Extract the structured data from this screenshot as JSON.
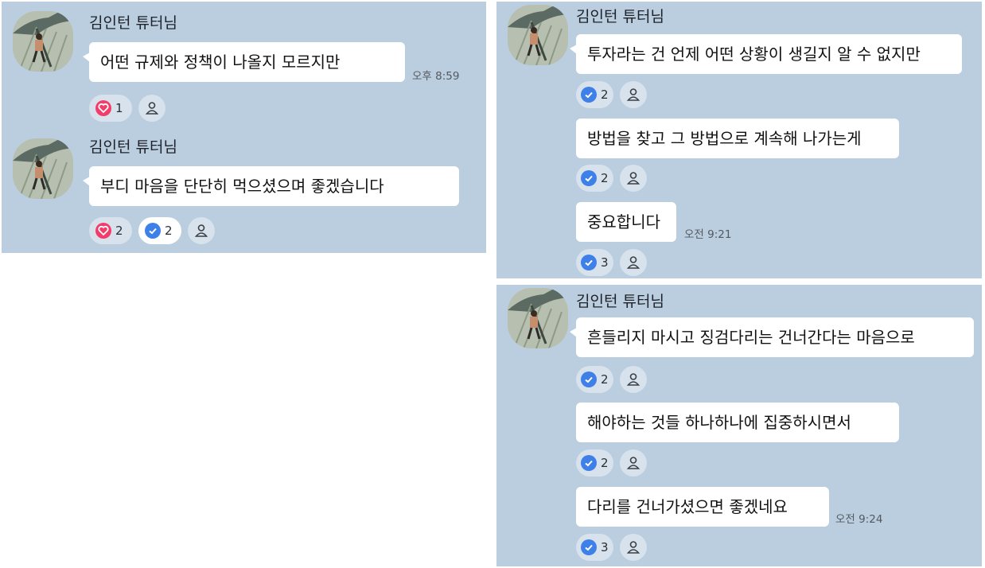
{
  "colors": {
    "panel_bg": "#bacee0",
    "bubble_bg": "#ffffff",
    "heart_red": "#f23c6a",
    "check_blue": "#3e80e8",
    "pill_bg": "#d7e2ec"
  },
  "panels": [
    {
      "groups": [
        {
          "sender": "김인턴 튜터님",
          "messages": [
            {
              "text": "어떤 규제와 정책이 나올지 모르지만",
              "time": "오후 8:59",
              "reactions": [
                {
                  "type": "heart",
                  "count": "1"
                }
              ]
            }
          ]
        },
        {
          "sender": "김인턴 튜터님",
          "messages": [
            {
              "text": "부디 마음을 단단히 먹으셨으며 좋겠습니다",
              "time": "",
              "reactions": [
                {
                  "type": "heart",
                  "count": "2"
                },
                {
                  "type": "check",
                  "count": "2",
                  "selected": true
                }
              ]
            }
          ]
        }
      ]
    },
    {
      "groups": [
        {
          "sender": "김인턴 튜터님",
          "messages": [
            {
              "text": "투자라는 건 언제 어떤 상황이 생길지 알 수 없지만",
              "time": "",
              "reactions": [
                {
                  "type": "check",
                  "count": "2"
                }
              ]
            },
            {
              "text": "방법을 찾고 그 방법으로 계속해 나가는게",
              "time": "",
              "reactions": [
                {
                  "type": "check",
                  "count": "2"
                }
              ]
            },
            {
              "text": "중요합니다",
              "time": "오전 9:21",
              "reactions": [
                {
                  "type": "check",
                  "count": "3"
                }
              ]
            }
          ]
        }
      ]
    },
    {
      "groups": [
        {
          "sender": "김인턴 튜터님",
          "messages": [
            {
              "text": "흔들리지 마시고 징검다리는 건너간다는 마음으로",
              "time": "",
              "reactions": [
                {
                  "type": "check",
                  "count": "2"
                }
              ]
            },
            {
              "text": "해야하는 것들 하나하나에 집중하시면서",
              "time": "",
              "reactions": [
                {
                  "type": "check",
                  "count": "2"
                }
              ]
            },
            {
              "text": "다리를 건너가셨으면 좋겠네요",
              "time": "오전 9:24",
              "reactions": [
                {
                  "type": "check",
                  "count": "3"
                }
              ]
            }
          ]
        }
      ]
    }
  ],
  "icons": {
    "heart": "heart-icon",
    "check": "check-icon",
    "add_reaction": "person-icon",
    "avatar": "profile-photo"
  }
}
